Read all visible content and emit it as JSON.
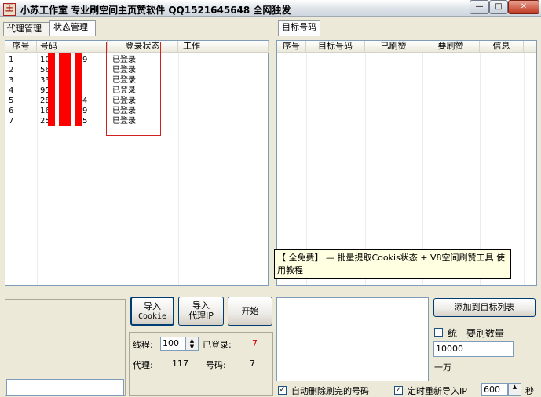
{
  "window": {
    "app_icon_text": "王",
    "title": "小苏工作室  专业刷空间主页赞软件 QQ1521645648 全网独发",
    "min_glyph": "—",
    "max_glyph": "□",
    "close_glyph": "✕"
  },
  "left_tabs": [
    "代理管理",
    "状态管理"
  ],
  "right_tabs": [
    "目标号码"
  ],
  "status_table": {
    "columns": [
      "序号",
      "号码",
      "登录状态",
      "工作"
    ],
    "rows": [
      {
        "seq": "1",
        "number": "10",
        "number_tail": "9",
        "status": "已登录"
      },
      {
        "seq": "2",
        "number": "56",
        "number_tail": "",
        "status": "已登录"
      },
      {
        "seq": "3",
        "number": "33",
        "number_tail": "",
        "status": "已登录"
      },
      {
        "seq": "4",
        "number": "95",
        "number_tail": "",
        "status": "已登录"
      },
      {
        "seq": "5",
        "number": "28",
        "number_tail": "4",
        "status": "已登录"
      },
      {
        "seq": "6",
        "number": "16",
        "number_tail": "9",
        "status": "已登录"
      },
      {
        "seq": "7",
        "number": "25",
        "number_tail": "5",
        "status": "已登录"
      }
    ]
  },
  "target_table": {
    "columns": [
      "序号",
      "目标号码",
      "已刷赞",
      "要刷赞",
      "信息"
    ]
  },
  "tooltip": "【 全免费】 — 批量提取Cookis状态 + V8空间刷赞工具 使用教程",
  "buttons": {
    "import_cookie": [
      "导入",
      "Cookie"
    ],
    "import_proxy": [
      "导入",
      "代理IP"
    ],
    "start": "开始",
    "add_to_target": "添加到目标列表"
  },
  "stats": {
    "threads_label": "线程:",
    "threads_value": "100",
    "logged_label": "已登录:",
    "logged_value": "7",
    "proxy_label": "代理:",
    "proxy_value": "117",
    "number_label": "号码:",
    "number_value": "7"
  },
  "options": {
    "unify_label": "统一要刷数量",
    "unify_checked": false,
    "count_value": "10000",
    "count_hint": "一万",
    "auto_delete_label": "自动删除刷完的号码",
    "auto_delete_checked": true,
    "reimport_label": "定时重新导入IP",
    "reimport_checked": true,
    "interval_value": "600",
    "interval_unit": "秒"
  }
}
